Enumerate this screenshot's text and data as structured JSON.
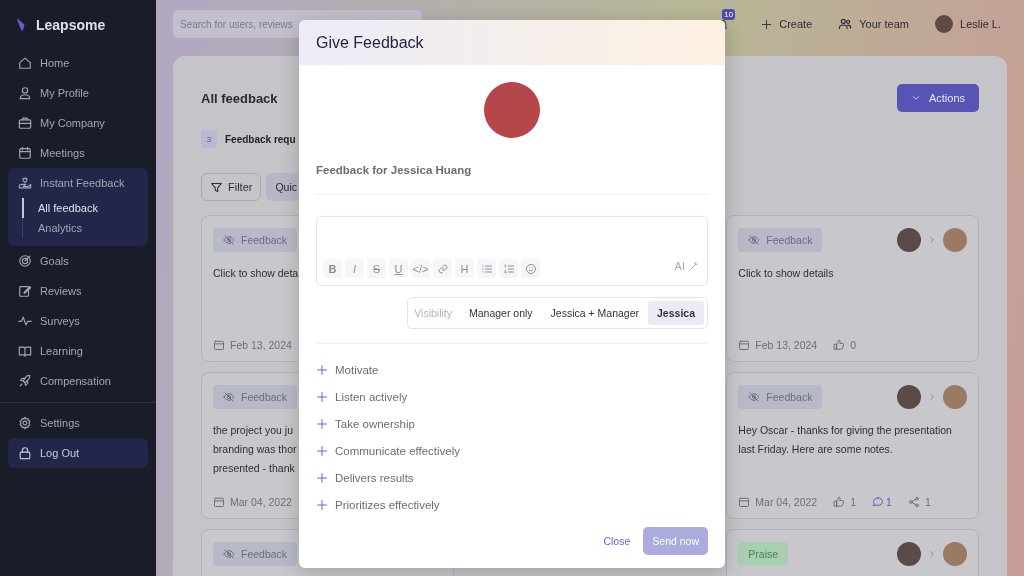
{
  "sidebar": {
    "logo": "Leapsome",
    "items": [
      {
        "label": "Home",
        "selected": false
      },
      {
        "label": "My Profile",
        "selected": false
      },
      {
        "label": "My Company",
        "selected": false
      },
      {
        "label": "Meetings",
        "selected": false
      },
      {
        "label": "Instant Feedback",
        "selected": false,
        "expanded": true,
        "children": [
          {
            "label": "All feedback",
            "selected": true
          },
          {
            "label": "Analytics",
            "selected": false
          }
        ]
      },
      {
        "label": "Goals",
        "selected": false
      },
      {
        "label": "Reviews",
        "selected": false
      },
      {
        "label": "Surveys",
        "selected": false
      },
      {
        "label": "Learning",
        "selected": false
      },
      {
        "label": "Compensation",
        "selected": false
      }
    ],
    "footer_items": [
      {
        "label": "Settings",
        "selected": false
      },
      {
        "label": "Log Out",
        "selected": true
      }
    ]
  },
  "topbar": {
    "search": {
      "placeholder": "Search for users, reviews"
    },
    "notification_badge": "10",
    "create": "Create",
    "team": "Your team",
    "user": "Leslie L."
  },
  "feed": {
    "title": "All feedback",
    "requests": {
      "count": "3",
      "label": "Feedback requ"
    },
    "filter": "Filter",
    "quick_button": "Quic",
    "actions": "Actions",
    "left_cards": [
      {
        "kind": "feedback",
        "tag": "Feedback",
        "lines": [
          "Click to show deta"
        ],
        "date": "Feb 13, 2024"
      },
      {
        "kind": "feedback",
        "tag": "Feedback",
        "lines": [
          "the project you ju",
          "branding was thor",
          "presented - thank"
        ],
        "date": "Mar 04, 2022"
      },
      {
        "kind": "feedback",
        "tag": "Feedback"
      }
    ],
    "right_cards": [
      {
        "kind": "feedback",
        "tag": "Feedback",
        "lines": [
          "Click to show details"
        ],
        "date": "Feb 13, 2024",
        "likes": "0"
      },
      {
        "kind": "feedback",
        "tag": "Feedback",
        "lines": [
          "Hey Oscar - thanks for giving the presentation",
          "last Friday. Here are some notes."
        ],
        "date": "Mar 04, 2022",
        "likes": "1",
        "comments": "1",
        "shares": "1"
      },
      {
        "kind": "praise",
        "tag": "Praise"
      }
    ]
  },
  "modal": {
    "title": "Give Feedback",
    "recipient": "Feedback for Jessica Huang",
    "toolbar": [
      {
        "kind": "bold",
        "label": "B"
      },
      {
        "kind": "italic",
        "label": "I"
      },
      {
        "kind": "strike",
        "label": "S"
      },
      {
        "kind": "underline",
        "label": "U"
      },
      {
        "kind": "code",
        "label": "</>"
      },
      {
        "kind": "link"
      },
      {
        "kind": "heading",
        "label": "H"
      },
      {
        "kind": "bullets"
      },
      {
        "kind": "numbers"
      },
      {
        "kind": "emoji"
      }
    ],
    "ai_label": "AI",
    "visibility": {
      "label": "Visibility",
      "options": [
        {
          "label": "Manager only",
          "selected": false
        },
        {
          "label": "Jessica + Manager",
          "selected": false
        },
        {
          "label": "Jessica",
          "selected": true
        }
      ]
    },
    "competencies": [
      "Motivate",
      "Listen actively",
      "Take ownership",
      "Communicate effectively",
      "Delivers results",
      "Prioritizes effectively"
    ],
    "close": "Close",
    "send": {
      "label": "Send now",
      "disabled": true
    }
  }
}
